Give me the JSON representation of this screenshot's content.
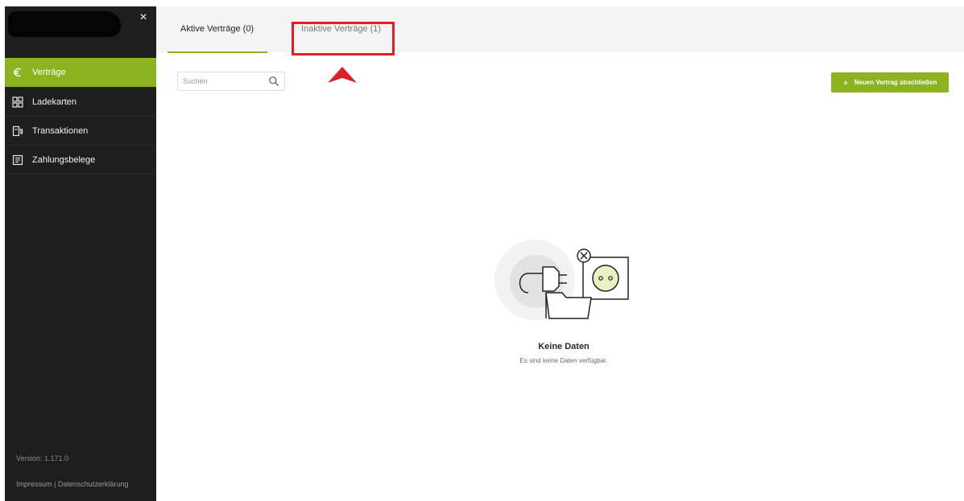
{
  "sidebar": {
    "close_icon": "×",
    "items": [
      {
        "label": "Verträge",
        "icon": "euro-icon",
        "active": true
      },
      {
        "label": "Ladekarten",
        "icon": "cards-grid-icon",
        "active": false
      },
      {
        "label": "Transaktionen",
        "icon": "charging-station-icon",
        "active": false
      },
      {
        "label": "Zahlungsbelege",
        "icon": "receipt-icon",
        "active": false
      }
    ],
    "version": "Version: 1.171.0",
    "footer": {
      "impressum": "Impressum",
      "separator": " | ",
      "privacy": "Datenschutzerklärung"
    }
  },
  "tabs": {
    "active": "Aktive Verträge (0)",
    "inactive": "Inaktive Verträge (1)"
  },
  "search": {
    "placeholder": "Suchen"
  },
  "actions": {
    "new_contract_plus": "+",
    "new_contract": "Neuen Vertrag abschließen"
  },
  "empty_state": {
    "title": "Keine Daten",
    "subtitle": "Es sind keine Daten verfügbar."
  },
  "colors": {
    "accent": "#8bb31f",
    "sidebar_bg": "#1e1e1e",
    "highlight": "#e01e26"
  }
}
